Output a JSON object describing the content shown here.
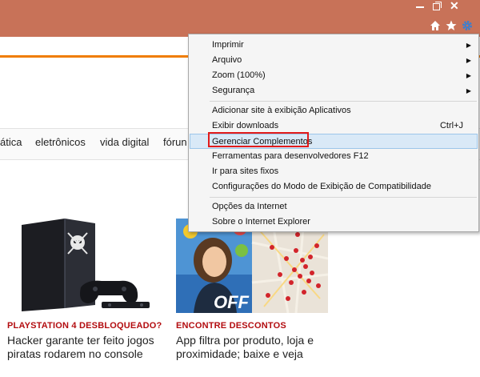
{
  "browser": {
    "window_controls": {
      "minimize": "minimize",
      "maximize": "maximize",
      "close": "✕"
    },
    "toolbar_icons": [
      "home-icon",
      "star-icon",
      "gear-icon"
    ]
  },
  "site": {
    "nav": [
      "ática",
      "eletrônicos",
      "vida digital",
      "fórun"
    ]
  },
  "articles": [
    {
      "kicker": "PLAYSTATION 4 DESBLOQUEADO?",
      "headline": "Hacker garante ter feito jogos piratas rodarem no console"
    },
    {
      "kicker": "ENCONTRE DESCONTOS",
      "headline": "App filtra por produto, loja e proximidade; baixe e veja",
      "badge": "OFF"
    }
  ],
  "menu": {
    "items": [
      {
        "label": "Imprimir",
        "submenu": true
      },
      {
        "label": "Arquivo",
        "submenu": true
      },
      {
        "label": "Zoom (100%)",
        "submenu": true
      },
      {
        "label": "Segurança",
        "submenu": true
      },
      {
        "label": "Adicionar site à exibição Aplicativos"
      },
      {
        "label": "Exibir downloads",
        "shortcut": "Ctrl+J"
      },
      {
        "label": "Gerenciar Complementos",
        "highlighted": true
      },
      {
        "label": "Ferramentas para desenvolvedores F12"
      },
      {
        "label": "Ir para sites fixos"
      },
      {
        "label": "Configurações do Modo de Exibição de Compatibilidade"
      },
      {
        "label": "Opções da Internet"
      },
      {
        "label": "Sobre o Internet Explorer"
      }
    ],
    "submenu_arrow": "▶"
  },
  "colors": {
    "titlebar": "#c87258",
    "accent_orange": "#f07d00",
    "kicker_red": "#b30d10",
    "highlight_box": "#e21b1b"
  }
}
